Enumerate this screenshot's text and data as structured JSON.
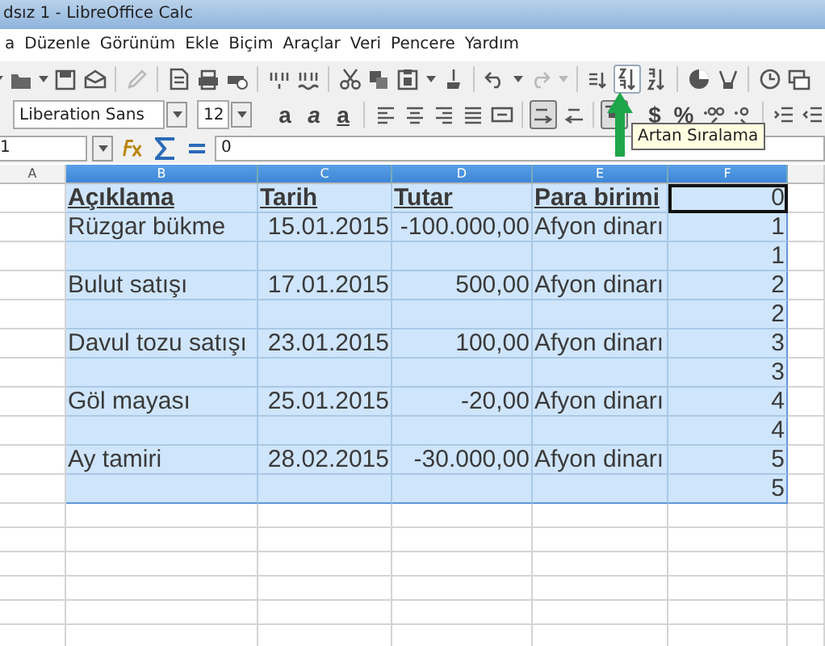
{
  "window": {
    "title": "dsız 1 - LibreOffice Calc"
  },
  "menu": [
    {
      "label": "a"
    },
    {
      "label": "Düzenle"
    },
    {
      "label": "Görünüm"
    },
    {
      "label": "Ekle"
    },
    {
      "label": "Biçim"
    },
    {
      "label": "Araçlar"
    },
    {
      "label": "Veri"
    },
    {
      "label": "Pencere"
    },
    {
      "label": "Yardım"
    }
  ],
  "toolbar_standard": [
    {
      "kind": "caret",
      "disabled": false,
      "highlighted": false
    },
    {
      "kind": "open",
      "disabled": false,
      "highlighted": false
    },
    {
      "kind": "caret",
      "disabled": false,
      "highlighted": false
    },
    {
      "kind": "save",
      "disabled": false,
      "highlighted": false
    },
    {
      "kind": "mail",
      "disabled": false,
      "highlighted": false
    },
    {
      "kind": "separator"
    },
    {
      "kind": "edit",
      "disabled": true,
      "highlighted": false
    },
    {
      "kind": "separator"
    },
    {
      "kind": "pdf",
      "disabled": false,
      "highlighted": false
    },
    {
      "kind": "print",
      "disabled": false,
      "highlighted": false
    },
    {
      "kind": "preview",
      "disabled": false,
      "highlighted": false
    },
    {
      "kind": "separator"
    },
    {
      "kind": "spell",
      "disabled": false,
      "highlighted": false
    },
    {
      "kind": "autospell",
      "disabled": false,
      "highlighted": false
    },
    {
      "kind": "separator"
    },
    {
      "kind": "cut",
      "disabled": false,
      "highlighted": false
    },
    {
      "kind": "copy",
      "disabled": false,
      "highlighted": false
    },
    {
      "kind": "paste",
      "disabled": false,
      "highlighted": false
    },
    {
      "kind": "caret",
      "disabled": false,
      "highlighted": false
    },
    {
      "kind": "brush",
      "disabled": false,
      "highlighted": false
    },
    {
      "kind": "separator"
    },
    {
      "kind": "undo",
      "disabled": false,
      "highlighted": false
    },
    {
      "kind": "caret",
      "disabled": false,
      "highlighted": false
    },
    {
      "kind": "redo",
      "disabled": true,
      "highlighted": false
    },
    {
      "kind": "caret",
      "disabled": true,
      "highlighted": false
    },
    {
      "kind": "separator"
    },
    {
      "kind": "sort",
      "disabled": false,
      "highlighted": false
    },
    {
      "kind": "sort-asc",
      "disabled": false,
      "highlighted": true
    },
    {
      "kind": "sort-desc",
      "disabled": false,
      "highlighted": false
    },
    {
      "kind": "separator"
    },
    {
      "kind": "chart",
      "disabled": false,
      "highlighted": false
    },
    {
      "kind": "pivot",
      "disabled": false,
      "highlighted": false
    },
    {
      "kind": "separator"
    },
    {
      "kind": "clock",
      "disabled": false,
      "highlighted": false
    },
    {
      "kind": "window",
      "disabled": false,
      "highlighted": false
    }
  ],
  "toolbar_format": {
    "font_name": "Liberation Sans",
    "font_size": "12",
    "buttons": [
      {
        "kind": "bold",
        "label": "a",
        "pressed": false
      },
      {
        "kind": "italic",
        "label": "a",
        "pressed": false
      },
      {
        "kind": "underline",
        "label": "a",
        "pressed": false
      },
      {
        "kind": "separator"
      },
      {
        "kind": "align-left",
        "pressed": false
      },
      {
        "kind": "align-center",
        "pressed": false
      },
      {
        "kind": "align-right",
        "pressed": false
      },
      {
        "kind": "justify",
        "pressed": false
      },
      {
        "kind": "merge",
        "pressed": false
      },
      {
        "kind": "separator"
      },
      {
        "kind": "wrap",
        "pressed": true
      },
      {
        "kind": "rtl",
        "pressed": false
      },
      {
        "kind": "separator"
      },
      {
        "kind": "align-top",
        "pressed": true
      },
      {
        "kind": "gap"
      },
      {
        "kind": "currency",
        "label": "$",
        "pressed": false
      },
      {
        "kind": "percent",
        "label": "%",
        "pressed": false
      },
      {
        "kind": "add-decimal",
        "pressed": false
      },
      {
        "kind": "remove-decimal",
        "pressed": false
      },
      {
        "kind": "separator"
      },
      {
        "kind": "indent",
        "pressed": false
      },
      {
        "kind": "outdent",
        "pressed": false
      }
    ]
  },
  "tooltip": {
    "text": "Artan Sıralama"
  },
  "formula_bar": {
    "name_box": "1",
    "value": "0"
  },
  "sheet": {
    "columns": [
      {
        "label": "A",
        "selected": false
      },
      {
        "label": "B",
        "selected": true
      },
      {
        "label": "C",
        "selected": true
      },
      {
        "label": "D",
        "selected": true
      },
      {
        "label": "E",
        "selected": true
      },
      {
        "label": "F",
        "selected": true
      }
    ],
    "rows": [
      {
        "kind": "header",
        "selected": true,
        "cells": [
          {
            "kind": "text",
            "text": "",
            "active": false
          },
          {
            "kind": "text",
            "text": "Açıklama",
            "active": false
          },
          {
            "kind": "text",
            "text": "Tarih",
            "active": false
          },
          {
            "kind": "text",
            "text": "Tutar",
            "active": false
          },
          {
            "kind": "text",
            "text": "Para birimi",
            "active": false
          },
          {
            "kind": "number",
            "text": "0",
            "active": true
          }
        ]
      },
      {
        "kind": "data",
        "selected": true,
        "cells": [
          {
            "kind": "text",
            "text": "",
            "active": false
          },
          {
            "kind": "text",
            "text": "Rüzgar bükme",
            "active": false
          },
          {
            "kind": "number",
            "text": "15.01.2015",
            "active": false
          },
          {
            "kind": "number",
            "text": "-100.000,00",
            "active": false
          },
          {
            "kind": "text",
            "text": "Afyon dinarı",
            "active": false
          },
          {
            "kind": "number",
            "text": "1",
            "active": false
          }
        ]
      },
      {
        "kind": "data",
        "selected": true,
        "cells": [
          {
            "kind": "text",
            "text": "",
            "active": false
          },
          {
            "kind": "text",
            "text": "",
            "active": false
          },
          {
            "kind": "text",
            "text": "",
            "active": false
          },
          {
            "kind": "text",
            "text": "",
            "active": false
          },
          {
            "kind": "text",
            "text": "",
            "active": false
          },
          {
            "kind": "number",
            "text": "1",
            "active": false
          }
        ]
      },
      {
        "kind": "data",
        "selected": true,
        "cells": [
          {
            "kind": "text",
            "text": "",
            "active": false
          },
          {
            "kind": "text",
            "text": "Bulut satışı",
            "active": false
          },
          {
            "kind": "number",
            "text": "17.01.2015",
            "active": false
          },
          {
            "kind": "number",
            "text": "500,00",
            "active": false
          },
          {
            "kind": "text",
            "text": "Afyon dinarı",
            "active": false
          },
          {
            "kind": "number",
            "text": "2",
            "active": false
          }
        ]
      },
      {
        "kind": "data",
        "selected": true,
        "cells": [
          {
            "kind": "text",
            "text": "",
            "active": false
          },
          {
            "kind": "text",
            "text": "",
            "active": false
          },
          {
            "kind": "text",
            "text": "",
            "active": false
          },
          {
            "kind": "text",
            "text": "",
            "active": false
          },
          {
            "kind": "text",
            "text": "",
            "active": false
          },
          {
            "kind": "number",
            "text": "2",
            "active": false
          }
        ]
      },
      {
        "kind": "data",
        "selected": true,
        "cells": [
          {
            "kind": "text",
            "text": "",
            "active": false
          },
          {
            "kind": "text",
            "text": "Davul tozu satışı",
            "active": false
          },
          {
            "kind": "number",
            "text": "23.01.2015",
            "active": false
          },
          {
            "kind": "number",
            "text": "100,00",
            "active": false
          },
          {
            "kind": "text",
            "text": "Afyon dinarı",
            "active": false
          },
          {
            "kind": "number",
            "text": "3",
            "active": false
          }
        ]
      },
      {
        "kind": "data",
        "selected": true,
        "cells": [
          {
            "kind": "text",
            "text": "",
            "active": false
          },
          {
            "kind": "text",
            "text": "",
            "active": false
          },
          {
            "kind": "text",
            "text": "",
            "active": false
          },
          {
            "kind": "text",
            "text": "",
            "active": false
          },
          {
            "kind": "text",
            "text": "",
            "active": false
          },
          {
            "kind": "number",
            "text": "3",
            "active": false
          }
        ]
      },
      {
        "kind": "data",
        "selected": true,
        "cells": [
          {
            "kind": "text",
            "text": "",
            "active": false
          },
          {
            "kind": "text",
            "text": "Göl mayası",
            "active": false
          },
          {
            "kind": "number",
            "text": "25.01.2015",
            "active": false
          },
          {
            "kind": "number",
            "text": "-20,00",
            "active": false
          },
          {
            "kind": "text",
            "text": "Afyon dinarı",
            "active": false
          },
          {
            "kind": "number",
            "text": "4",
            "active": false
          }
        ]
      },
      {
        "kind": "data",
        "selected": true,
        "cells": [
          {
            "kind": "text",
            "text": "",
            "active": false
          },
          {
            "kind": "text",
            "text": "",
            "active": false
          },
          {
            "kind": "text",
            "text": "",
            "active": false
          },
          {
            "kind": "text",
            "text": "",
            "active": false
          },
          {
            "kind": "text",
            "text": "",
            "active": false
          },
          {
            "kind": "number",
            "text": "4",
            "active": false
          }
        ]
      },
      {
        "kind": "data",
        "selected": true,
        "cells": [
          {
            "kind": "text",
            "text": "",
            "active": false
          },
          {
            "kind": "text",
            "text": "Ay tamiri",
            "active": false
          },
          {
            "kind": "number",
            "text": "28.02.2015",
            "active": false
          },
          {
            "kind": "number",
            "text": "-30.000,00",
            "active": false
          },
          {
            "kind": "text",
            "text": "Afyon dinarı",
            "active": false
          },
          {
            "kind": "number",
            "text": "5",
            "active": false
          }
        ]
      },
      {
        "kind": "data",
        "selected": true,
        "cells": [
          {
            "kind": "text",
            "text": "",
            "active": false
          },
          {
            "kind": "text",
            "text": "",
            "active": false
          },
          {
            "kind": "text",
            "text": "",
            "active": false
          },
          {
            "kind": "text",
            "text": "",
            "active": false
          },
          {
            "kind": "text",
            "text": "",
            "active": false
          },
          {
            "kind": "number",
            "text": "5",
            "active": false
          }
        ]
      }
    ]
  }
}
